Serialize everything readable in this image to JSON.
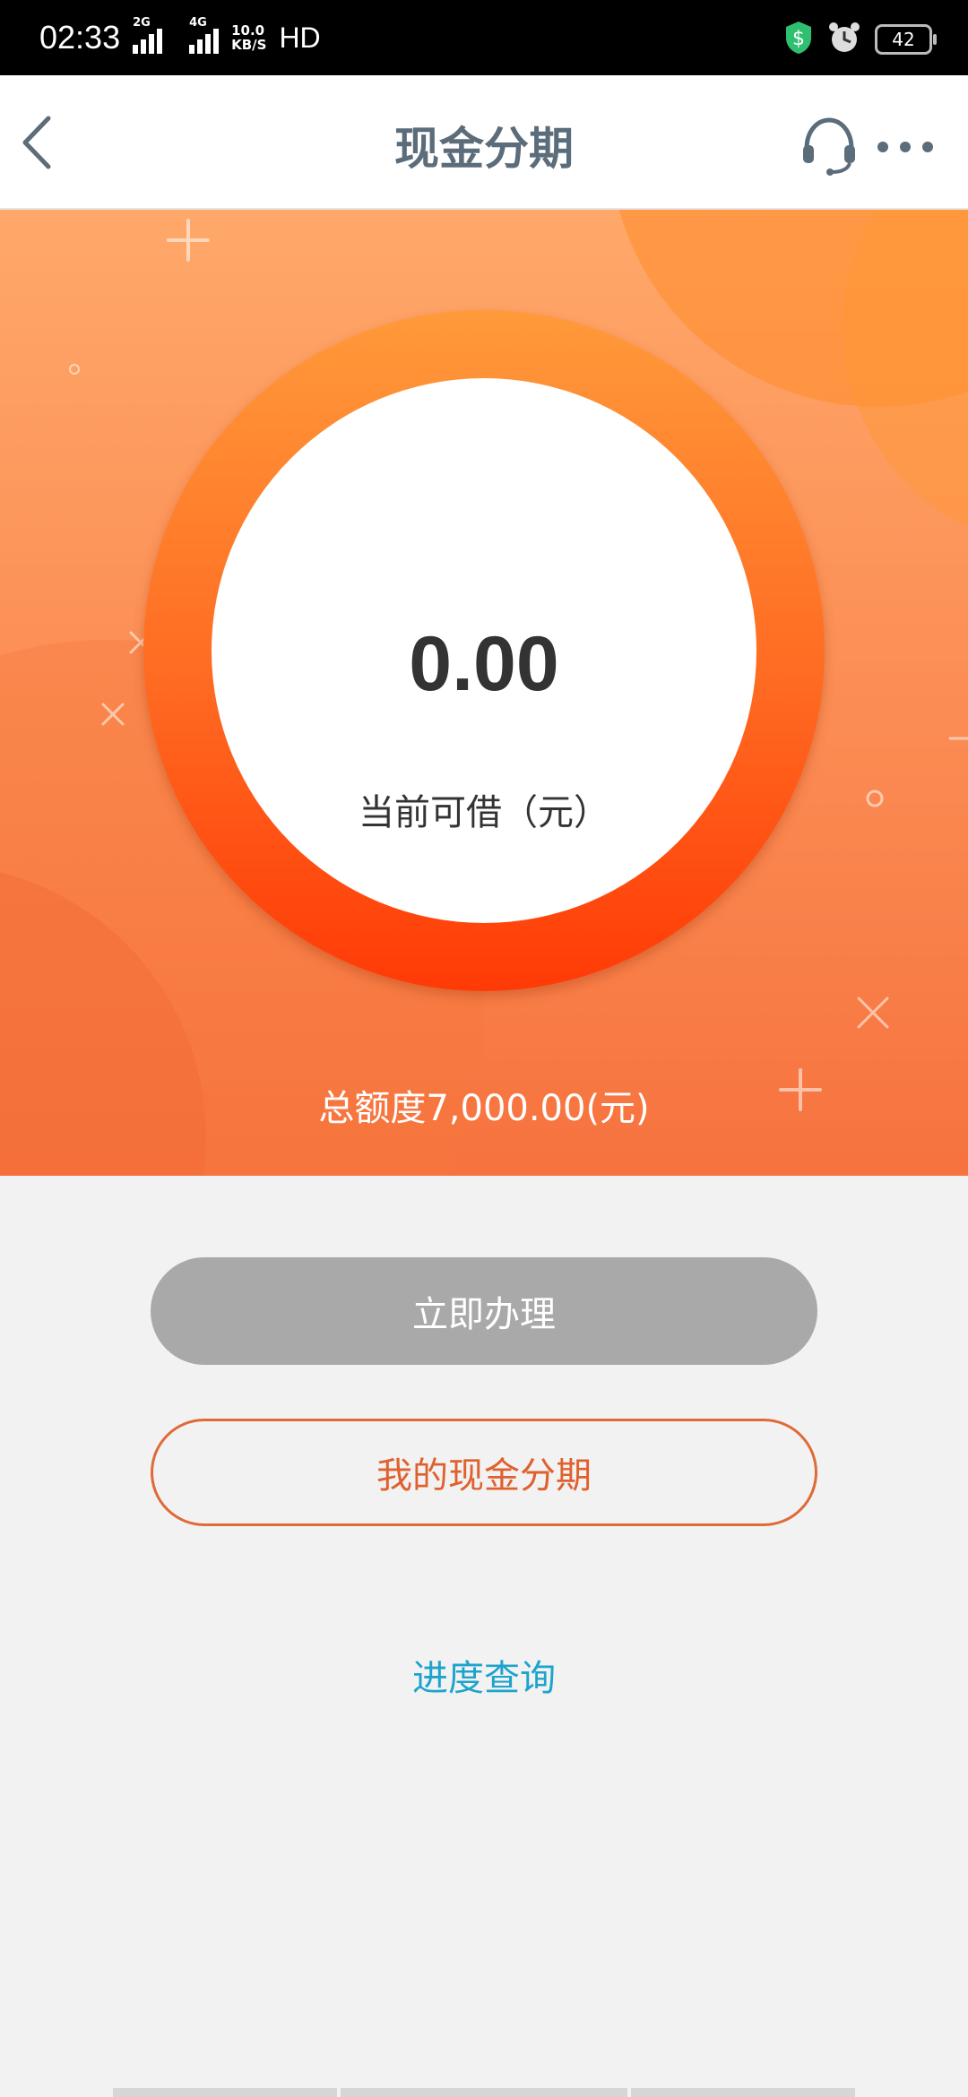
{
  "status_bar": {
    "time": "02:33",
    "signal1_label": "2G",
    "signal2_label": "4G",
    "speed_value": "10.0",
    "speed_unit": "KB/S",
    "hd_label": "HD",
    "battery": "42"
  },
  "header": {
    "title": "现金分期"
  },
  "hero": {
    "available_amount": "0.00",
    "available_label": "当前可借（元）",
    "total_limit": "总额度7,000.00(元)"
  },
  "actions": {
    "apply_label": "立即办理",
    "my_installment_label": "我的现金分期",
    "progress_query_label": "进度查询"
  },
  "colors": {
    "ring_top": "#ff9a3a",
    "ring_bottom": "#ff3a06",
    "hero_bg": "#fb8b52",
    "apply_disabled": "#a9a9a9",
    "accent_orange": "#e06a38",
    "link_blue": "#1ea4cc"
  },
  "icons": {
    "back": "back-arrow-icon",
    "service": "headset-icon",
    "more": "more-dots-icon",
    "security": "shield-dollar-icon",
    "alarm": "alarm-clock-icon"
  }
}
